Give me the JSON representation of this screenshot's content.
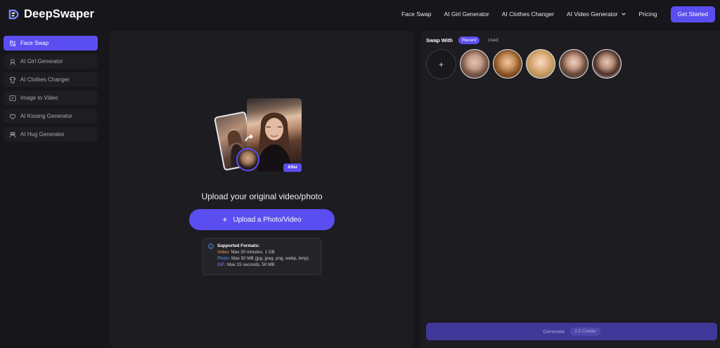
{
  "brand": {
    "name": "DeepSwaper",
    "logo_icon": "ds-logo-icon"
  },
  "nav": {
    "items": [
      "Face Swap",
      "AI Girl Generator",
      "AI Clothes Changer",
      "AI Video Generator",
      "Pricing"
    ],
    "cta": "Get Started"
  },
  "sidebar": {
    "items": [
      {
        "label": "Face Swap",
        "icon": "face-swap-icon",
        "active": true
      },
      {
        "label": "AI Girl Generator",
        "icon": "girl-icon",
        "active": false
      },
      {
        "label": "AI Clothes Changer",
        "icon": "shirt-icon",
        "active": false
      },
      {
        "label": "Image to Video",
        "icon": "play-icon",
        "active": false
      },
      {
        "label": "AI Kissing Generator",
        "icon": "heart-icon",
        "active": false
      },
      {
        "label": "AI Hug Generator",
        "icon": "hug-icon",
        "active": false
      }
    ]
  },
  "upload": {
    "after_badge": "After",
    "title": "Upload your original video/photo",
    "button_label": "Upload a Photo/Video",
    "formats": {
      "heading": "Supported Formats:",
      "video_label": "Video:",
      "video_value": "Max 30 minutes, 1 GB",
      "photo_label": "Photo:",
      "photo_value": "Max 50 MB (jpg, jpeg, png, webp, bmp)",
      "gif_label": "GIF:",
      "gif_value": "Max 15 seconds, 50 MB"
    }
  },
  "swap": {
    "label": "Swap With",
    "tabs": [
      "Recent",
      "Used"
    ],
    "add_symbol": "+",
    "generate_label": "Generate",
    "credits": "0.5 Credits"
  },
  "colors": {
    "accent": "#5b4ef0",
    "background": "#16161b",
    "panel": "#1c1c21"
  }
}
